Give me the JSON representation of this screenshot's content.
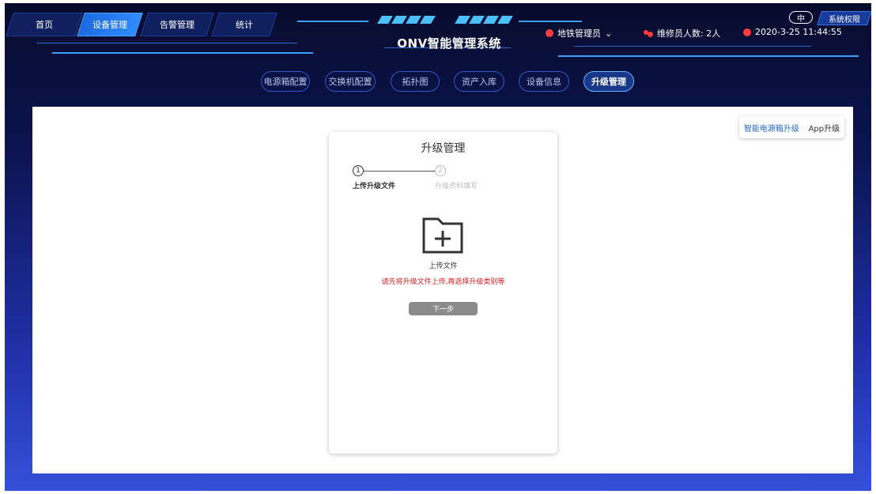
{
  "nav": {
    "tabs": [
      {
        "label": "首页"
      },
      {
        "label": "设备管理"
      },
      {
        "label": "告警管理"
      },
      {
        "label": "统计"
      }
    ]
  },
  "header": {
    "title": "ONV智能管理系统",
    "user": "地铁管理员",
    "maintainers": "维修员人数: 2人",
    "datetime": "2020-3-25 11:44:55",
    "lang": "中",
    "permission": "系统权限",
    "accent_color": "#2f8cff",
    "alert_color": "#ff3b3b"
  },
  "subnav": {
    "tabs": [
      {
        "label": "电源箱配置"
      },
      {
        "label": "交换机配置"
      },
      {
        "label": "拓扑图"
      },
      {
        "label": "资产入库"
      },
      {
        "label": "设备信息"
      },
      {
        "label": "升级管理"
      }
    ]
  },
  "upgrade_tabs": {
    "smart_box": "智能电源箱升级",
    "app": "App升级"
  },
  "card": {
    "title": "升级管理",
    "step1_num": "1",
    "step2_num": "2",
    "step1_label": "上传升级文件",
    "step2_label": "升级资料填写",
    "upload_label": "上传文件",
    "warning": "请先将升级文件上传,再选择升级类别等",
    "next_button": "下一步",
    "warning_color": "#e02020"
  }
}
